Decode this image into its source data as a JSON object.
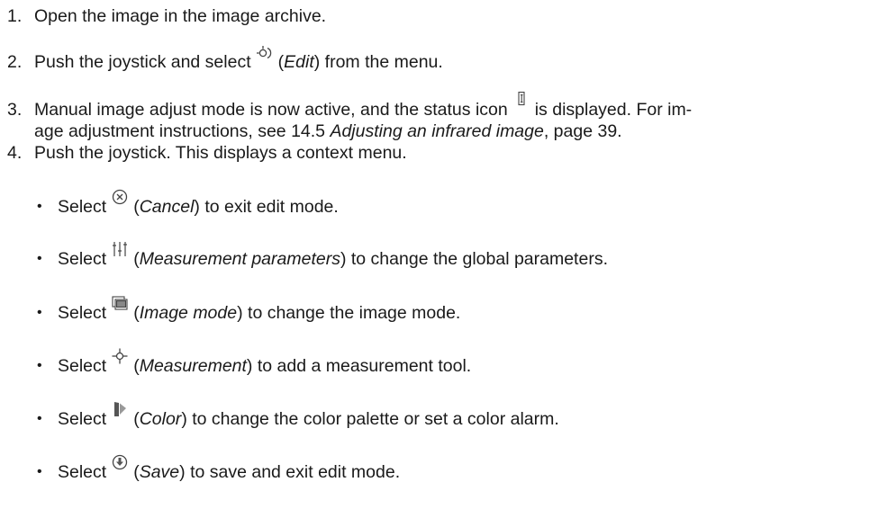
{
  "steps": [
    {
      "num": "1.",
      "text": "Open the image in the image archive."
    },
    {
      "num": "2.",
      "pre": "Push the joystick and select",
      "icon": "edit-icon",
      "italic": "Edit",
      "post": ") from the menu."
    },
    {
      "num": "3.",
      "pre": "Manual image adjust mode is now active, and the status icon",
      "icon": "manual-adjust-icon",
      "post": "is displayed. For im-",
      "cont_pre": "age adjustment instructions, see 14.5 ",
      "cont_italic": "Adjusting an infrared image",
      "cont_post": ", page 39."
    },
    {
      "num": "4.",
      "text": "Push the joystick. This displays a context menu."
    }
  ],
  "options": [
    {
      "select": "Select",
      "icon": "cancel-icon",
      "label": "Cancel",
      "desc": ") to exit edit mode."
    },
    {
      "select": "Select",
      "icon": "measurement-parameters-icon",
      "label": "Measurement parameters",
      "desc": ") to change the global parameters."
    },
    {
      "select": "Select",
      "icon": "image-mode-icon",
      "label": "Image mode",
      "desc": ") to change the image mode."
    },
    {
      "select": "Select",
      "icon": "measurement-icon",
      "label": "Measurement",
      "desc": ") to add a measurement tool."
    },
    {
      "select": "Select",
      "icon": "color-icon",
      "label": "Color",
      "desc": ") to change the color palette or set a color alarm."
    },
    {
      "select": "Select",
      "icon": "save-icon",
      "label": "Save",
      "desc": ") to save and exit edit mode."
    }
  ],
  "bullet_char": "•",
  "open_paren": "("
}
